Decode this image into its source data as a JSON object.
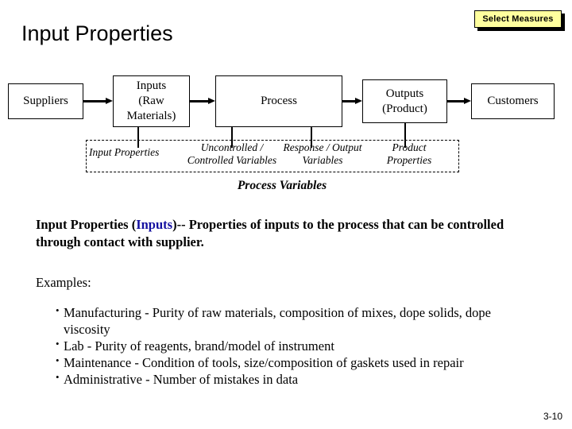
{
  "slide": {
    "title": "Input Properties",
    "page_number": "3-10"
  },
  "toolbar": {
    "select_measures_label": "Select Measures",
    "select_measures_bg": "#ffff9e",
    "select_measures_border": "#000000"
  },
  "diagram": {
    "type": "sipoc-process-flow",
    "boxes": [
      {
        "id": "suppliers",
        "label": "Suppliers",
        "lines": [
          "Suppliers"
        ]
      },
      {
        "id": "inputs",
        "label": "Inputs (Raw Materials)",
        "lines": [
          "Inputs",
          "(Raw",
          "Materials)"
        ]
      },
      {
        "id": "process",
        "label": "Process",
        "lines": [
          "Process"
        ]
      },
      {
        "id": "outputs",
        "label": "Outputs (Product)",
        "lines": [
          "Outputs",
          "(Product)"
        ]
      },
      {
        "id": "customers",
        "label": "Customers",
        "lines": [
          "Customers"
        ]
      }
    ],
    "process_variables": {
      "caption": "Process Variables",
      "items": [
        {
          "id": "input-properties",
          "lines": [
            "Input Properties"
          ]
        },
        {
          "id": "uncontrolled-controlled",
          "lines": [
            "Uncontrolled /",
            "Controlled Variables"
          ]
        },
        {
          "id": "response-output",
          "lines": [
            "Response / Output",
            "Variables"
          ]
        },
        {
          "id": "product-properties",
          "lines": [
            "Product",
            "Properties"
          ]
        }
      ]
    }
  },
  "body": {
    "definition": {
      "term": "Input Properties",
      "open_paren": " (",
      "highlight": "Inputs",
      "close_paren": ")",
      "text": "-- Properties of inputs to the process that can be controlled through contact with supplier.",
      "highlight_color": "#1410a0"
    },
    "examples_label": "Examples:",
    "examples": [
      "Manufacturing - Purity of raw materials, composition of mixes, dope solids, dope viscosity",
      "Lab - Purity of reagents, brand/model of instrument",
      "Maintenance - Condition of tools, size/composition of gaskets used in repair",
      "Administrative - Number of mistakes in data"
    ]
  }
}
